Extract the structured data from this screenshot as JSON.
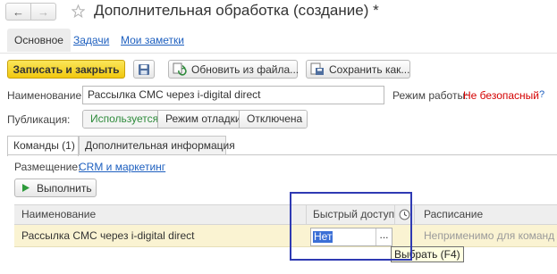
{
  "window": {
    "back_glyph": "←",
    "forward_glyph": "→",
    "title": "Дополнительная обработка (создание) *"
  },
  "nav_tabs": {
    "main": "Основное",
    "tasks": "Задачи",
    "notes": "Мои заметки"
  },
  "toolbar": {
    "save_close": "Записать и закрыть",
    "update_from_file": "Обновить из файла...",
    "save_as": "Сохранить как..."
  },
  "form": {
    "name_label": "Наименование:",
    "name_value": "Рассылка СМС через i-digital direct",
    "mode_label": "Режим работы:",
    "mode_value": "Не безопасный",
    "mode_help": "?",
    "publication_label": "Публикация:",
    "publication_options": [
      "Используется",
      "Режим отладки",
      "Отключена"
    ],
    "publication_selected": "Используется"
  },
  "inner_tabs": {
    "commands": "Команды (1)",
    "extra_info": "Дополнительная информация"
  },
  "placement": {
    "label": "Размещение:",
    "value": "CRM и маркетинг"
  },
  "run_button": "Выполнить",
  "table": {
    "headers": {
      "name": "Наименование",
      "quick_access": "Быстрый доступ",
      "schedule": "Расписание"
    },
    "rows": [
      {
        "name": "Рассылка СМС через i-digital direct",
        "quick_access": "Нет",
        "schedule": "Неприменимо для команд с в"
      }
    ],
    "cell_more": "..."
  },
  "tooltip": "Выбрать (F4)",
  "colors": {
    "primary_button": "#f1c80f",
    "link": "#1d5fbf",
    "warning": "#d40000",
    "active_option": "#2e8b3b",
    "selected_row": "#faf3d2",
    "highlight_box": "#2f3ab3",
    "tooltip_bg": "#ffffe1"
  }
}
